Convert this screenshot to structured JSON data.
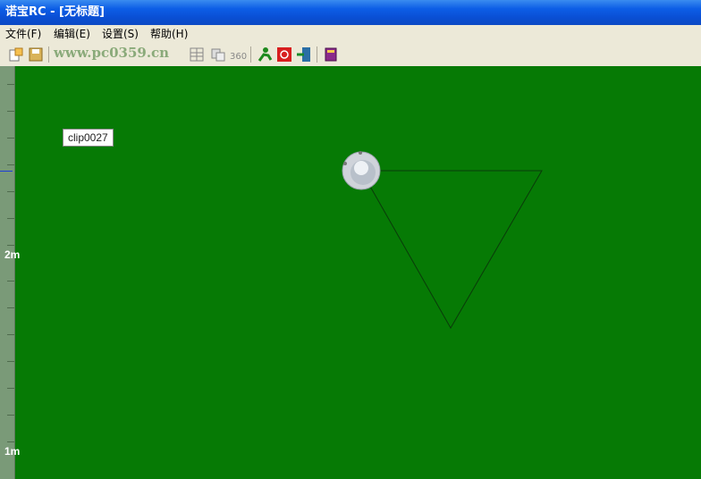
{
  "window": {
    "title": "诺宝RC - [无标题]"
  },
  "menu": {
    "items": [
      "文件(F)",
      "编辑(E)",
      "设置(S)",
      "帮助(H)"
    ]
  },
  "watermark": "www.pc0359.cn",
  "canvas": {
    "background_color": "#067a05",
    "ruler_labels": [
      "2m",
      "1m"
    ],
    "clip_label": "clip0027"
  },
  "toolbar": {
    "icons": [
      "new-file-icon",
      "save-icon",
      "grid-icon",
      "copy-icon",
      "rotate-360-icon",
      "run-robot-icon",
      "stop-icon",
      "exit-icon",
      "help-book-icon"
    ]
  }
}
